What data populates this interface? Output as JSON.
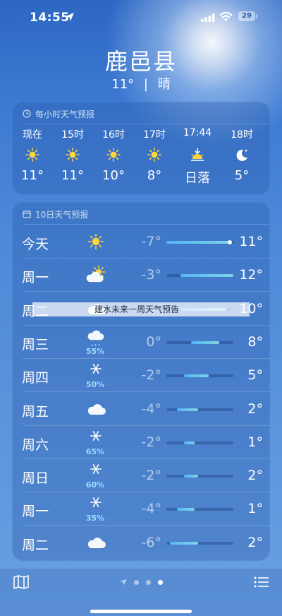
{
  "status_bar": {
    "time": "14:55",
    "battery": "29"
  },
  "header": {
    "city": "鹿邑县",
    "temp": "11°",
    "separator": "|",
    "condition": "晴"
  },
  "hourly": {
    "title": "每小时天气预报",
    "items": [
      {
        "time": "现在",
        "icon": "sun-icon",
        "temp": "11°"
      },
      {
        "time": "15时",
        "icon": "sun-icon",
        "temp": "11°"
      },
      {
        "time": "16时",
        "icon": "sun-icon",
        "temp": "10°"
      },
      {
        "time": "17时",
        "icon": "sun-icon",
        "temp": "8°"
      },
      {
        "time": "17:44",
        "icon": "sunset-icon",
        "temp": "日落"
      },
      {
        "time": "18时",
        "icon": "moon-stars-icon",
        "temp": "5°"
      }
    ]
  },
  "daily": {
    "title": "10日天气预报",
    "temp_scale": {
      "min": -7,
      "max": 12
    },
    "current_temp": 11,
    "days": [
      {
        "day": "今天",
        "icon": "sun-icon",
        "precip": "",
        "low": "-7°",
        "high": "11°",
        "low_v": -7,
        "high_v": 11
      },
      {
        "day": "周一",
        "icon": "partly-cloudy-icon",
        "precip": "",
        "low": "-3°",
        "high": "12°",
        "low_v": -3,
        "high_v": 12
      },
      {
        "day": "周二",
        "icon": "cloud-icon",
        "precip": "",
        "low": "",
        "high": "10°",
        "low_v": -3,
        "high_v": 10
      },
      {
        "day": "周三",
        "icon": "rain-icon",
        "precip": "55%",
        "low": "0°",
        "high": "8°",
        "low_v": 0,
        "high_v": 8
      },
      {
        "day": "周四",
        "icon": "snowflake-icon",
        "precip": "50%",
        "low": "-2°",
        "high": "5°",
        "low_v": -2,
        "high_v": 5
      },
      {
        "day": "周五",
        "icon": "cloud-icon",
        "precip": "",
        "low": "-4°",
        "high": "2°",
        "low_v": -4,
        "high_v": 2
      },
      {
        "day": "周六",
        "icon": "snowflake-icon",
        "precip": "65%",
        "low": "-2°",
        "high": "1°",
        "low_v": -2,
        "high_v": 1
      },
      {
        "day": "周日",
        "icon": "snowflake-icon",
        "precip": "60%",
        "low": "-2°",
        "high": "2°",
        "low_v": -2,
        "high_v": 2
      },
      {
        "day": "周一",
        "icon": "snowflake-icon",
        "precip": "35%",
        "low": "-4°",
        "high": "1°",
        "low_v": -4,
        "high_v": 1
      },
      {
        "day": "周二",
        "icon": "cloud-icon",
        "precip": "",
        "low": "-6°",
        "high": "2°",
        "low_v": -6,
        "high_v": 2
      }
    ]
  },
  "overlay_caption": "建水未来一周天气预告",
  "toolbar": {
    "left_icon": "map-icon",
    "right_icon": "list-icon",
    "page_indicator_icons": [
      "location-arrow-icon",
      "page-dot",
      "page-dot",
      "page-dot-active"
    ]
  }
}
